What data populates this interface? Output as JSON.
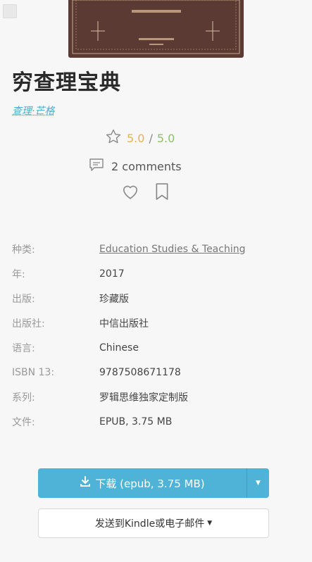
{
  "book": {
    "title": "穷查理宝典",
    "author": "查理·芒格"
  },
  "rating": {
    "value": "5.0",
    "separator": "/",
    "max": "5.0"
  },
  "comments": {
    "label": "2 comments"
  },
  "details": [
    {
      "label": "种类:",
      "value": "Education Studies & Teaching"
    },
    {
      "label": "年:",
      "value": "2017"
    },
    {
      "label": "出版:",
      "value": "珍藏版"
    },
    {
      "label": "出版社:",
      "value": "中信出版社"
    },
    {
      "label": "语言:",
      "value": "Chinese"
    },
    {
      "label": "ISBN 13:",
      "value": "9787508671178"
    },
    {
      "label": "系列:",
      "value": "罗辑思维独家定制版"
    },
    {
      "label": "文件:",
      "value": "EPUB, 3.75 MB"
    }
  ],
  "download": {
    "label": "下载 (epub, 3.75 MB)"
  },
  "kindle": {
    "label": "发送到Kindle或电子邮件"
  },
  "icons": {
    "star": "star-outline-icon",
    "comment": "comment-icon",
    "heart": "heart-outline-icon",
    "bookmark": "bookmark-outline-icon",
    "download": "download-icon",
    "caret": "caret-down-icon"
  },
  "colors": {
    "accent": "#4eb3d6",
    "rating": "#e6b34a",
    "rating_max": "#8fbf6a",
    "cover": "#5a3a32"
  }
}
